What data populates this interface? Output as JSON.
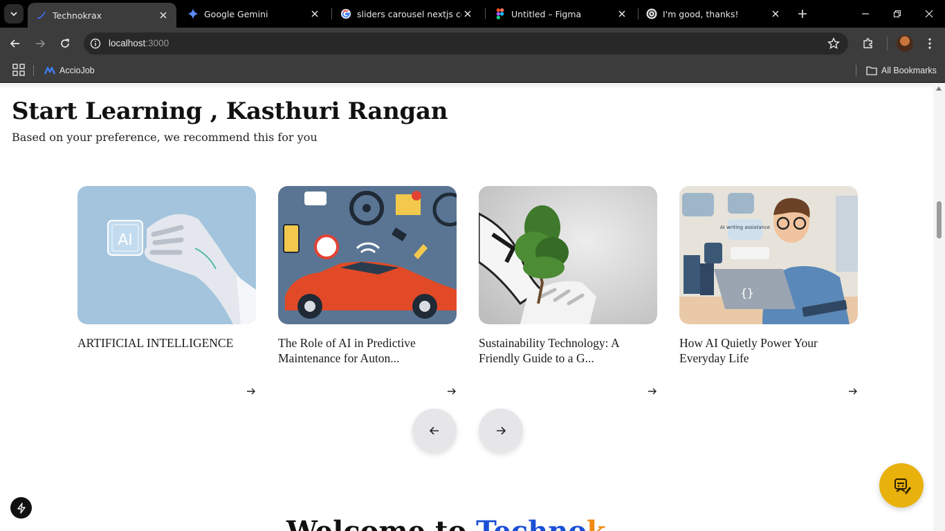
{
  "browser": {
    "tabs": [
      {
        "title": "Technokrax",
        "active": true,
        "icon": "technokrax-logo-icon"
      },
      {
        "title": "Google Gemini",
        "active": false,
        "icon": "gemini-icon"
      },
      {
        "title": "sliders carousel nextjs comp",
        "active": false,
        "icon": "google-icon"
      },
      {
        "title": "Untitled – Figma",
        "active": false,
        "icon": "figma-icon"
      },
      {
        "title": "I'm good, thanks!",
        "active": false,
        "icon": "chatgpt-icon"
      }
    ],
    "address": {
      "host": "localhost",
      "port": ":3000"
    },
    "bookmarks": [
      {
        "label": "AccioJob",
        "icon": "acciojob-icon"
      }
    ],
    "all_bookmarks_label": "All Bookmarks"
  },
  "page": {
    "heading": "Start Learning , Kasthuri Rangan",
    "subheading": "Based on your preference, we recommend this for you",
    "cards": [
      {
        "title": "ARTIFICIAL INTELLIGENCE",
        "image": "robot-hand-ai-chip",
        "image_text": "AI"
      },
      {
        "title": "The Role of AI in Predictive Maintenance for Auton...",
        "image": "red-car-maintenance-icons"
      },
      {
        "title": "Sustainability Technology: A Friendly Guide to a G...",
        "image": "robot-hands-holding-tree"
      },
      {
        "title": "How AI Quietly Power Your Everyday Life",
        "image": "man-at-laptop-illustration",
        "image_text": "AI writing assistance"
      }
    ],
    "carousel": {
      "prev_icon": "arrow-left-icon",
      "next_icon": "arrow-right-icon"
    },
    "welcome": {
      "prefix": "Welcome to ",
      "brand_part1": "Techno",
      "brand_part2": "k"
    }
  },
  "colors": {
    "brand_blue": "#1a4fd6",
    "brand_orange": "#f08a10",
    "help_button": "#e9b10c",
    "nav_button": "#e6e6e9"
  }
}
